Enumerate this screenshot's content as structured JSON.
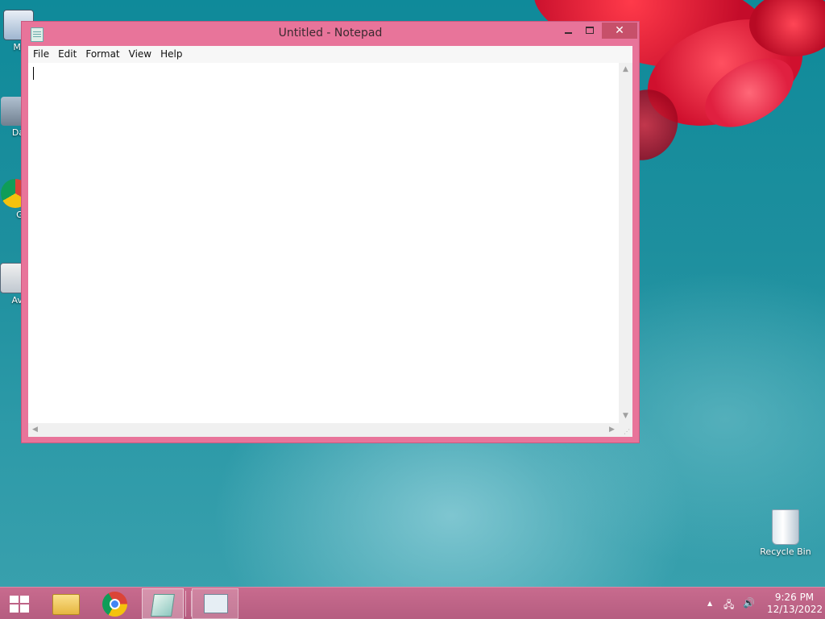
{
  "notepad": {
    "title": "Untitled - Notepad",
    "menu": [
      "File",
      "Edit",
      "Format",
      "View",
      "Help"
    ],
    "content": "",
    "close_glyph": "✕"
  },
  "desktop_icons": [
    {
      "label": "My C",
      "icon": "computer-icon"
    },
    {
      "label": "Data",
      "icon": "shortcut-icon"
    },
    {
      "label": "G C",
      "icon": "chrome-shortcut-icon"
    },
    {
      "label": "Av Ar",
      "icon": "shortcut-icon"
    },
    {
      "label": "Recycle Bin",
      "icon": "recycle-bin-icon"
    }
  ],
  "taskbar": {
    "pinned": [
      "file-explorer-icon",
      "chrome-icon",
      "notepad-icon",
      "performance-monitor-icon"
    ],
    "clock_time": "9:26 PM",
    "clock_date": "12/13/2022",
    "tray_icons": [
      "show-hidden-icons-arrow",
      "network-icon",
      "volume-icon"
    ]
  },
  "colors": {
    "window_border": "#e8749a",
    "taskbar": "#c86b8e",
    "close_button": "#c7506a"
  }
}
